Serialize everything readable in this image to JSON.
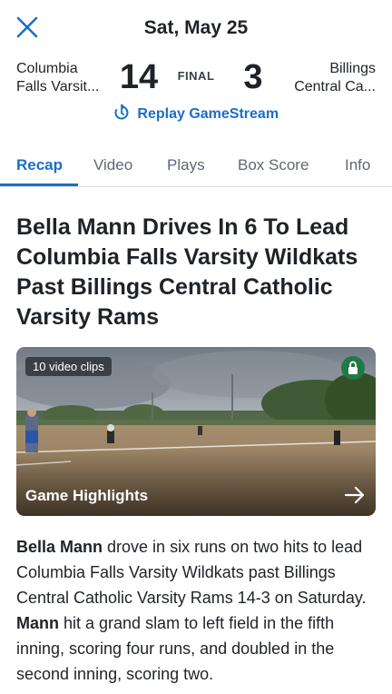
{
  "header": {
    "close_icon": "close-icon",
    "date": "Sat, May 25"
  },
  "game": {
    "home_team_line1": "Columbia",
    "home_team_line2": "Falls Varsit...",
    "home_score": "14",
    "status": "FINAL",
    "away_score": "3",
    "away_team_line1": "Billings",
    "away_team_line2": "Central Ca...",
    "replay_label": "Replay GameStream",
    "replay_icon": "replay-icon"
  },
  "tabs": [
    {
      "label": "Recap",
      "active": true
    },
    {
      "label": "Video",
      "active": false
    },
    {
      "label": "Plays",
      "active": false
    },
    {
      "label": "Box Score",
      "active": false
    },
    {
      "label": "Info",
      "active": false
    }
  ],
  "article": {
    "headline": "Bella Mann Drives In 6 To Lead Columbia Falls Varsity Wildkats Past Billings Central Catholic Varsity Rams",
    "media": {
      "clips_badge": "10 video clips",
      "title": "Game Highlights",
      "lock_icon": "lock-icon",
      "arrow_icon": "arrow-right-icon"
    },
    "summary": {
      "name1": "Bella Mann",
      "text1": " drove in six runs on two hits to lead Columbia Falls Varsity Wildkats past Billings Central Catholic Varsity Rams 14-3 on Saturday. ",
      "name2": "Mann",
      "text2": " hit a grand slam to left field in the fifth inning, scoring four runs, and doubled in the second inning, scoring two."
    }
  },
  "colors": {
    "accent": "#1a6fc4",
    "lock_badge": "#1f7a44",
    "text": "#1f2328"
  }
}
